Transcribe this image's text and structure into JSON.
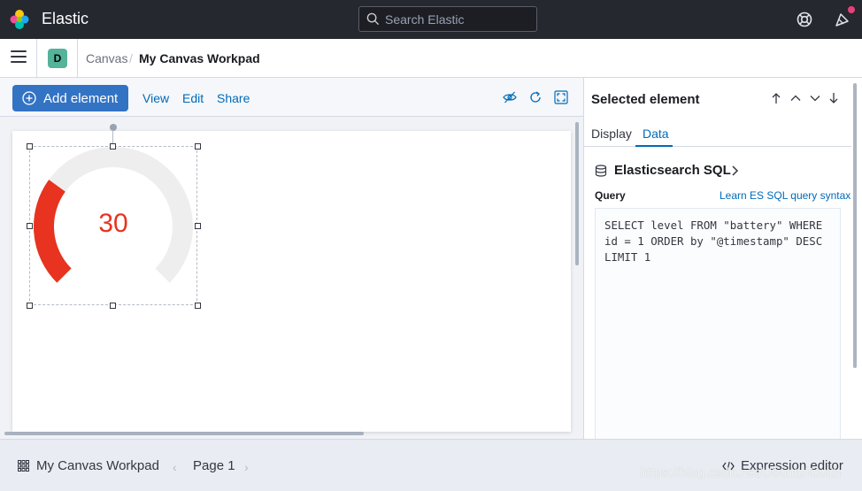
{
  "header": {
    "app_title": "Elastic",
    "search_placeholder": "Search Elastic",
    "icons": [
      "elastic-logo",
      "help-icon",
      "newsfeed-icon"
    ]
  },
  "breadcrumb": {
    "space_initial": "D",
    "items": [
      "Canvas",
      "My Canvas Workpad"
    ],
    "separator": "/"
  },
  "toolbar": {
    "add_element_label": "Add element",
    "links": [
      "View",
      "Edit",
      "Share"
    ],
    "icons": [
      "eye-closed-icon",
      "refresh-icon",
      "fullscreen-icon"
    ]
  },
  "canvas": {
    "gauge": {
      "value": "30",
      "min": 0,
      "max": 100,
      "fill_color": "#e7331f",
      "track_color": "#eeeeee"
    }
  },
  "sidebar": {
    "title": "Selected element",
    "tabs": [
      "Display",
      "Data"
    ],
    "active_tab": "Data",
    "datasource_title": "Elasticsearch SQL",
    "query_label": "Query",
    "query_help_link": "Learn ES SQL query syntax",
    "query_text": "SELECT level FROM \"battery\" WHERE id = 1 ORDER by \"@timestamp\" DESC LIMIT 1"
  },
  "footer": {
    "workpad_title": "My Canvas Workpad",
    "page_label": "Page 1",
    "expression_editor_label": "Expression editor"
  },
  "watermark": "https://blog.csdn.net/UbuntuTouch",
  "colors": {
    "header_bg": "#25282f",
    "primary": "#3373c4",
    "link": "#006bb8",
    "accent_badge": "#54b399",
    "notification": "#e7417a"
  }
}
